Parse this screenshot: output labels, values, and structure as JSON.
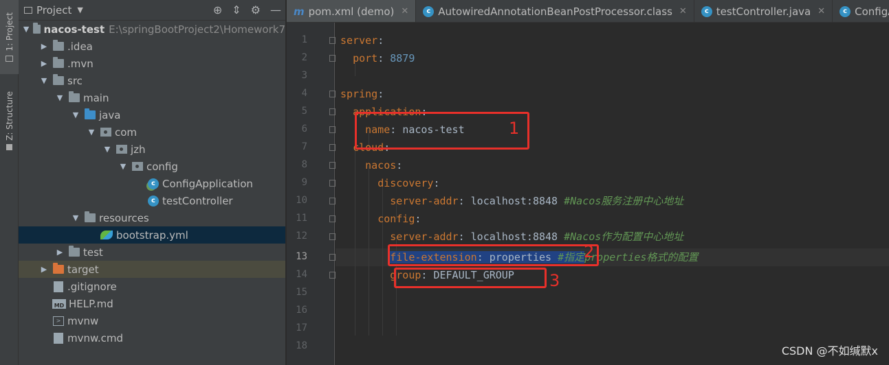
{
  "toolstrip": {
    "project_tab": "1: Project",
    "structure_tab": "Z: Structure"
  },
  "project_panel": {
    "title": "Project",
    "tools": [
      "target-icon",
      "collapse-icon",
      "gear-icon",
      "minimize-icon"
    ],
    "tree": [
      {
        "label": "nacos-test",
        "path": "E:\\springBootProject2\\Homework7",
        "level": 0,
        "arrow": "open",
        "icon": "folder-icon"
      },
      {
        "label": ".idea",
        "level": 1,
        "arrow": "closed",
        "icon": "folder-icon"
      },
      {
        "label": ".mvn",
        "level": 1,
        "arrow": "closed",
        "icon": "folder-icon"
      },
      {
        "label": "src",
        "level": 1,
        "arrow": "open",
        "icon": "folder-icon"
      },
      {
        "label": "main",
        "level": 2,
        "arrow": "open",
        "icon": "folder-icon"
      },
      {
        "label": "java",
        "level": 3,
        "arrow": "open",
        "icon": "source-folder-icon"
      },
      {
        "label": "com",
        "level": 4,
        "arrow": "open",
        "icon": "package-icon"
      },
      {
        "label": "jzh",
        "level": 5,
        "arrow": "open",
        "icon": "package-icon"
      },
      {
        "label": "config",
        "level": 6,
        "arrow": "open",
        "icon": "package-icon"
      },
      {
        "label": "ConfigApplication",
        "level": 7,
        "arrow": "none",
        "icon": "spring-class-icon"
      },
      {
        "label": "testController",
        "level": 7,
        "arrow": "none",
        "icon": "class-icon"
      },
      {
        "label": "resources",
        "level": 3,
        "arrow": "open",
        "icon": "resources-folder-icon"
      },
      {
        "label": "bootstrap.yml",
        "level": 4,
        "arrow": "none",
        "icon": "spring-yaml-icon",
        "selected": true
      },
      {
        "label": "test",
        "level": 2,
        "arrow": "closed",
        "icon": "folder-icon"
      },
      {
        "label": "target",
        "level": 1,
        "arrow": "closed",
        "icon": "excluded-folder-icon",
        "excluded": true
      },
      {
        "label": ".gitignore",
        "level": 1,
        "arrow": "none",
        "icon": "file-icon"
      },
      {
        "label": "HELP.md",
        "level": 1,
        "arrow": "none",
        "icon": "markdown-icon"
      },
      {
        "label": "mvnw",
        "level": 1,
        "arrow": "none",
        "icon": "terminal-icon"
      },
      {
        "label": "mvnw.cmd",
        "level": 1,
        "arrow": "none",
        "icon": "file-icon"
      }
    ]
  },
  "editor": {
    "tabs": [
      {
        "label": "pom.xml (demo)",
        "icon": "m"
      },
      {
        "label": "AutowiredAnnotationBeanPostProcessor.class",
        "icon": "c"
      },
      {
        "label": "testController.java",
        "icon": "c"
      },
      {
        "label": "ConfigA",
        "icon": "c"
      }
    ],
    "current_line": 13,
    "lines": [
      {
        "n": "1"
      },
      {
        "n": "2"
      },
      {
        "n": "3"
      },
      {
        "n": "4"
      },
      {
        "n": "5"
      },
      {
        "n": "6"
      },
      {
        "n": "7"
      },
      {
        "n": "8"
      },
      {
        "n": "9"
      },
      {
        "n": "10"
      },
      {
        "n": "11"
      },
      {
        "n": "12"
      },
      {
        "n": "13"
      },
      {
        "n": "14"
      },
      {
        "n": "15"
      },
      {
        "n": "16"
      },
      {
        "n": "17"
      },
      {
        "n": "18"
      }
    ],
    "code": {
      "l1_key": "server",
      "l1_colon": ":",
      "l2_key": "port",
      "l2_colon": ": ",
      "l2_val": "8879",
      "l4_key": "spring",
      "l4_colon": ":",
      "l5_key": "application",
      "l5_colon": ":",
      "l6_key": "name",
      "l6_colon": ": ",
      "l6_val": "nacos-test",
      "l7_key": "cloud",
      "l7_colon": ":",
      "l8_key": "nacos",
      "l8_colon": ":",
      "l9_key": "discovery",
      "l9_colon": ":",
      "l10_key": "server-addr",
      "l10_colon": ": ",
      "l10_val": "localhost:8848 ",
      "l10_comment": "#Nacos服务注册中心地址",
      "l11_key": "config",
      "l11_colon": ":",
      "l12_key": "server-addr",
      "l12_colon": ": ",
      "l12_val": "localhost:8848 ",
      "l12_comment": "#Nacos作为配置中心地址",
      "l13_key": "file-extension",
      "l13_colon": ": ",
      "l13_val": "properties ",
      "l13_comment_a": "#指定",
      "l13_comment_b": "properties格式的配置",
      "l14_key": "group",
      "l14_colon": ": ",
      "l14_val": "DEFAULT_GROUP"
    }
  },
  "annotations": {
    "labels": [
      "1",
      "2",
      "3"
    ],
    "color": "#e8302a"
  },
  "watermark": "CSDN @不如缄默x"
}
